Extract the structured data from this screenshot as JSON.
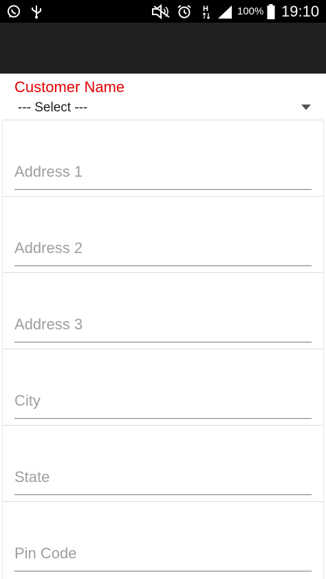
{
  "status_bar": {
    "icons": [
      "whatsapp-icon",
      "usb-icon",
      "mute-icon",
      "alarm-icon",
      "hspa-icon",
      "signal-icon",
      "battery-icon"
    ],
    "battery": "100%",
    "time": "19:10"
  },
  "form": {
    "customer": {
      "label": "Customer Name",
      "selected": "--- Select ---"
    },
    "fields": [
      {
        "placeholder": "Address 1"
      },
      {
        "placeholder": "Address 2"
      },
      {
        "placeholder": "Address 3"
      },
      {
        "placeholder": "City"
      },
      {
        "placeholder": "State"
      },
      {
        "placeholder": "Pin Code"
      }
    ]
  },
  "colors": {
    "status_bar": "#000000",
    "toolbar": "#212121",
    "label_accent": "#e00000",
    "placeholder": "#9e9e9e"
  }
}
